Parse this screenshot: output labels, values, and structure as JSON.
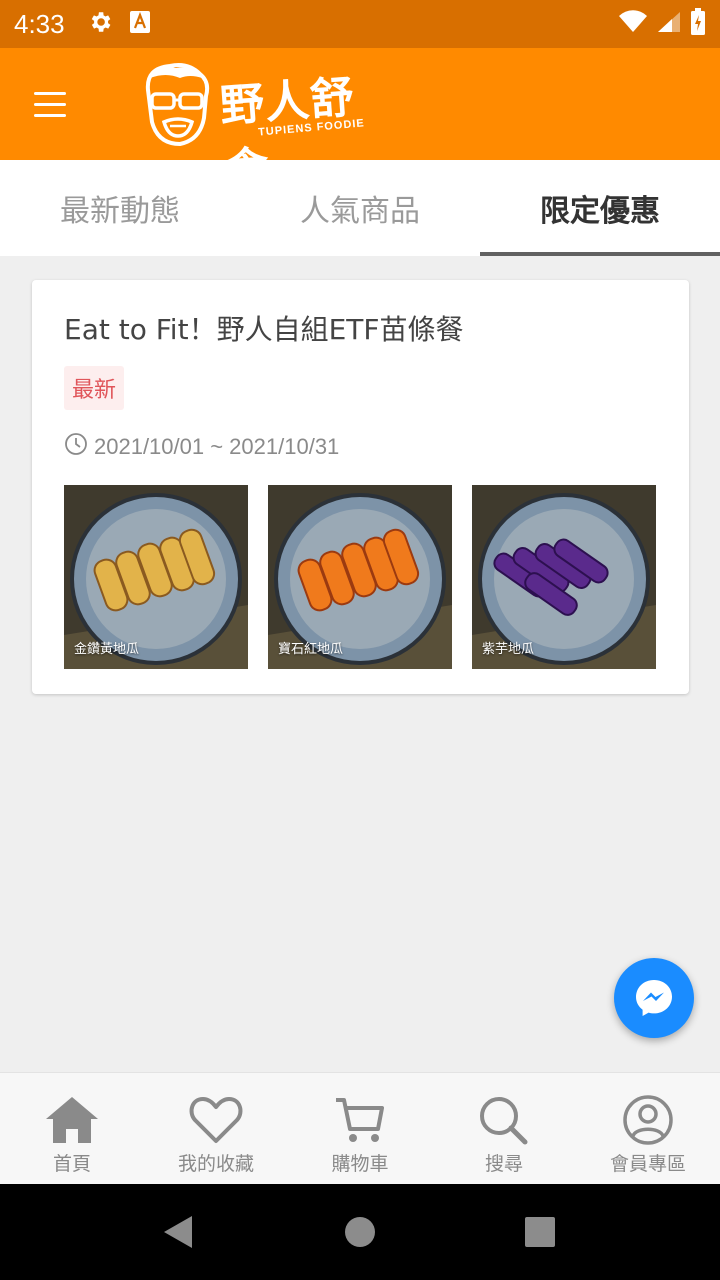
{
  "status_bar": {
    "time": "4:33"
  },
  "app_bar": {
    "brand_name": "野人舒食",
    "brand_subtitle": "TUPIENS FOODIE"
  },
  "tabs": [
    {
      "label": "最新動態",
      "active": false
    },
    {
      "label": "人氣商品",
      "active": false
    },
    {
      "label": "限定優惠",
      "active": true
    }
  ],
  "promo": {
    "title": "Eat to Fit！野人自組ETF苗條餐",
    "badge": "最新",
    "date_range": "2021/10/01 ~ 2021/10/31",
    "images": [
      {
        "label": "金鑽黃地瓜"
      },
      {
        "label": "寶石紅地瓜"
      },
      {
        "label": "紫芋地瓜"
      }
    ]
  },
  "bottom_nav": [
    {
      "label": "首頁",
      "icon": "home-icon"
    },
    {
      "label": "我的收藏",
      "icon": "heart-icon"
    },
    {
      "label": "購物車",
      "icon": "cart-icon"
    },
    {
      "label": "搜尋",
      "icon": "search-icon"
    },
    {
      "label": "會員專區",
      "icon": "user-icon"
    }
  ],
  "colors": {
    "brand_orange": "#ff8a00",
    "status_bar": "#d86f00",
    "messenger_blue": "#1a8cff",
    "badge_red": "#e0555a"
  }
}
